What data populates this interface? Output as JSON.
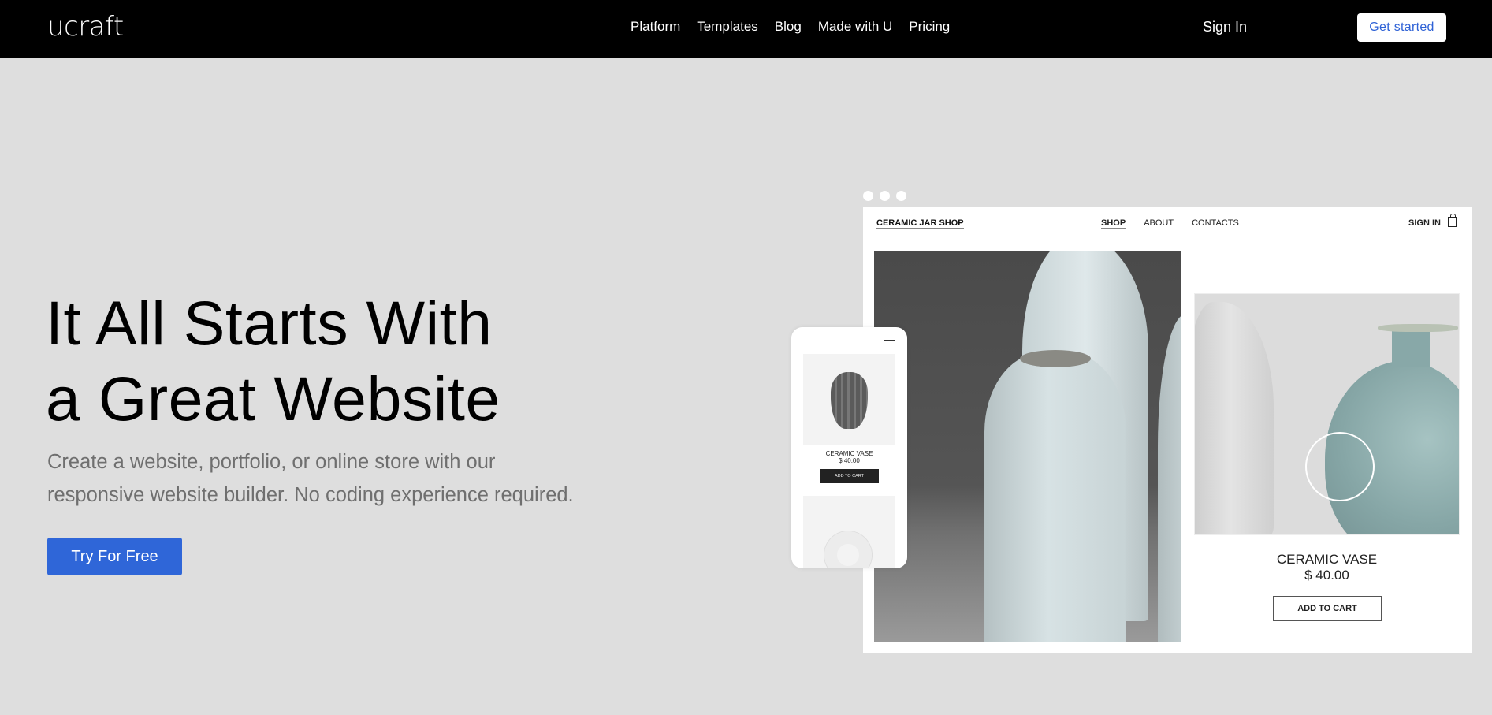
{
  "header": {
    "logo": "ucraft",
    "nav": [
      "Platform",
      "Templates",
      "Blog",
      "Made with U",
      "Pricing"
    ],
    "sign_in": "Sign In",
    "get_started": "Get started"
  },
  "hero": {
    "title_line1": "It All Starts With",
    "title_line2": "a Great Website",
    "subtitle_line1": "Create a website, portfolio, or online store with our",
    "subtitle_line2": "responsive website builder. No coding experience required.",
    "cta": "Try For Free"
  },
  "preview": {
    "shop_name": "CERAMIC JAR SHOP",
    "nav": [
      "SHOP",
      "ABOUT",
      "CONTACTS"
    ],
    "active_nav": "SHOP",
    "sign_in": "SIGN IN",
    "cart_icon": "shopping-bag-icon",
    "product": {
      "name": "CERAMIC VASE",
      "price": "$ 40.00",
      "button": "ADD TO CART"
    },
    "mobile": {
      "menu_icon": "hamburger-icon",
      "product_name": "CERAMIC VASE",
      "product_price": "$ 40.00",
      "button": "ADD TO CART"
    }
  },
  "colors": {
    "accent": "#2f66d8",
    "header_bg": "#000000",
    "page_bg": "#dedede"
  }
}
